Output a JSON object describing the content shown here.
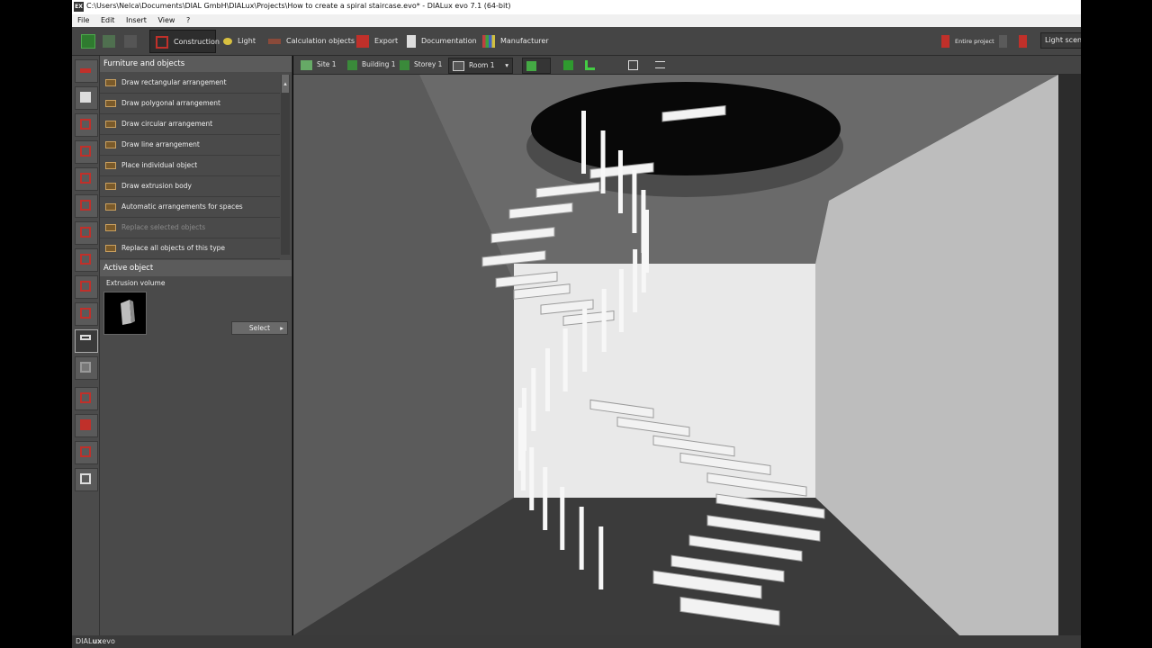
{
  "window": {
    "title": "C:\\Users\\Nelca\\Documents\\DIAL GmbH\\DIALux\\Projects\\How to create a spiral staircase.evo* - DIALux evo 7.1  (64-bit)",
    "app_icon": "EX"
  },
  "menu": [
    "File",
    "Edit",
    "Insert",
    "View",
    "?"
  ],
  "toolbar": {
    "tabs": [
      "Construction",
      "Light",
      "Calculation objects",
      "Export",
      "Documentation",
      "Manufacturer"
    ],
    "right": {
      "entire_project": "Entire project",
      "light_scene": "Light scene"
    }
  },
  "panel": {
    "section_title": "Furniture and objects",
    "items": [
      {
        "label": "Draw rectangular arrangement",
        "disabled": false
      },
      {
        "label": "Draw polygonal arrangement",
        "disabled": false
      },
      {
        "label": "Draw circular arrangement",
        "disabled": false
      },
      {
        "label": "Draw line arrangement",
        "disabled": false
      },
      {
        "label": "Place individual object",
        "disabled": false
      },
      {
        "label": "Draw extrusion body",
        "disabled": false
      },
      {
        "label": "Automatic arrangements for spaces",
        "disabled": false
      },
      {
        "label": "Replace selected objects",
        "disabled": true
      },
      {
        "label": "Replace all objects of this type",
        "disabled": false
      }
    ],
    "active_object_title": "Active object",
    "active_object_name": "Extrusion volume",
    "select_button": "Select",
    "select_arrow": "▸"
  },
  "viewbar": {
    "breadcrumbs": [
      "Site 1",
      "Building 1",
      "Storey 1",
      "Room 1"
    ],
    "room_dropdown_arrow": "▾"
  },
  "status": {
    "brand_a": "DIAL",
    "brand_b": "ux",
    "brand_c": "evo"
  },
  "colors": {
    "accent_red": "#c0302a",
    "accent_green": "#3a8a3a",
    "panel_bg": "#4a4a4a"
  }
}
